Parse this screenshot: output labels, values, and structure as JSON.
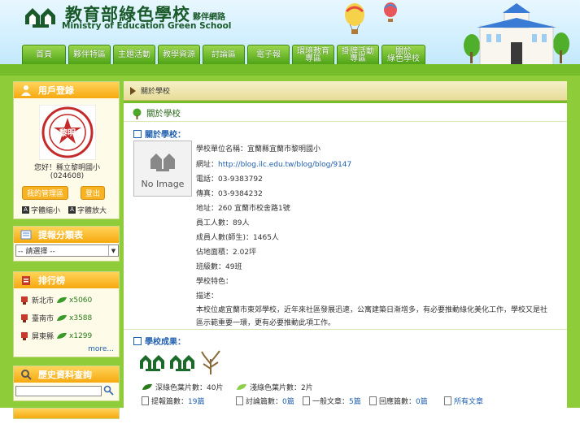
{
  "header": {
    "title": "教育部綠色學校",
    "subtitle": "夥伴網路",
    "english": "Ministry of Education Green School"
  },
  "nav": {
    "tabs": [
      "首頁",
      "夥伴特區",
      "主題活動",
      "教學資源",
      "討論區",
      "電子報"
    ],
    "tabs2": [
      [
        "環境教育",
        "專區"
      ],
      [
        "掛牌活動",
        "專區"
      ],
      [
        "關於",
        "綠色學校"
      ]
    ]
  },
  "sidebar": {
    "login": {
      "title": "用戶登錄",
      "badge": "黎明",
      "greeting": "您好！縣立黎明國小",
      "account": "(024608)",
      "manage": "我的管理區",
      "logout": "登出",
      "font_small": "字體縮小",
      "font_big": "字體放大"
    },
    "category": {
      "title": "提報分類表",
      "select_value": "-- 請選擇 --"
    },
    "ranking": {
      "title": "排行榜",
      "items": [
        {
          "name": "新北市",
          "count": "x5060"
        },
        {
          "name": "臺南市",
          "count": "x3588"
        },
        {
          "name": "屏東縣",
          "count": "x1299"
        }
      ],
      "more": "more..."
    },
    "history": {
      "title": "歷史資料查詢"
    }
  },
  "main": {
    "breadcrumb": "關於學校",
    "page_title": "關於學校",
    "about_header": "關於學校：",
    "no_image": "No Image",
    "info": [
      {
        "label": "學校單位名稱：",
        "value": "宜蘭縣宜蘭市黎明國小"
      },
      {
        "label": "網址：",
        "value": "http://blog.ilc.edu.tw/blog/blog/9147"
      },
      {
        "label": "電話：",
        "value": "03-9383792"
      },
      {
        "label": "傳真：",
        "value": "03-9384232"
      },
      {
        "label": "地址：",
        "value": "260 宜蘭市校舍路1號"
      },
      {
        "label": "員工人數：",
        "value": "89人"
      },
      {
        "label": "成員人數(師生)：",
        "value": "1465人"
      },
      {
        "label": "佔地面積：",
        "value": "2.02坪"
      },
      {
        "label": "班級數：",
        "value": "49班"
      },
      {
        "label": "學校特色：",
        "value": ""
      },
      {
        "label": "描述：",
        "value": ""
      }
    ],
    "description": [
      "本校位處宜蘭市東郊學校，近年來社區發展迅速，公寓建築日漸增多，有必要推動綠化美化工作，學校又是社",
      "區示範重要一環，更有必要推動此項工作。"
    ],
    "results_header": "學校成果：",
    "deep_leaves": "深綠色葉片數：40片",
    "light_leaves": "淺綠色葉片數：2片",
    "stats": [
      {
        "label": "提報篇數：",
        "value": "19篇"
      },
      {
        "label": "討論篇數：",
        "value": "0篇"
      },
      {
        "label": "一般文章：",
        "value": "5篇"
      },
      {
        "label": "回應篇數：",
        "value": "0篇"
      },
      {
        "label": "",
        "value": "所有文章"
      }
    ]
  },
  "colors": {
    "green": "#76bd2a",
    "link": "#1f5fb0",
    "orange": "#f6a90f"
  }
}
